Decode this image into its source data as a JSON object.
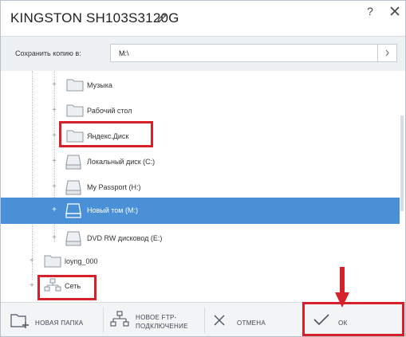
{
  "window": {
    "title": "KINGSTON SH103S3120G",
    "help_glyph": "?",
    "close_icon": "close-icon",
    "edit_icon": "pencil-icon"
  },
  "save_to": {
    "label": "Сохранить копию в:",
    "value": "M:\\",
    "go_icon": "chevron-right-icon"
  },
  "tree": {
    "items": [
      {
        "label": "Музыка",
        "icon": "folder-icon",
        "expander": "+"
      },
      {
        "label": "Рабочий стол",
        "icon": "folder-icon",
        "expander": "+"
      },
      {
        "label": "Яндекс.Диск",
        "icon": "folder-icon",
        "expander": "+"
      },
      {
        "label": "Локальный диск (C:)",
        "icon": "drive-icon",
        "expander": "+"
      },
      {
        "label": "My Passport (H:)",
        "icon": "drive-icon",
        "expander": "+"
      },
      {
        "label": "Новый том (M:)",
        "icon": "drive-icon",
        "expander": "+",
        "selected": true
      },
      {
        "label": "DVD RW дисковод (E:)",
        "icon": "drive-icon",
        "expander": "+"
      },
      {
        "label": "loyng_000",
        "icon": "folder-icon",
        "expander": "+"
      },
      {
        "label": "Сеть",
        "icon": "network-icon",
        "expander": "+"
      }
    ]
  },
  "toolbar": {
    "new_folder": "НОВАЯ ПАПКА",
    "new_ftp_line1": "НОВОЕ FTP-",
    "new_ftp_line2": "ПОДКЛЮЧЕНИЕ",
    "cancel": "ОТМЕНА",
    "ok": "ОК"
  },
  "colors": {
    "selection": "#4a90d6",
    "annotation": "#d8202a"
  }
}
